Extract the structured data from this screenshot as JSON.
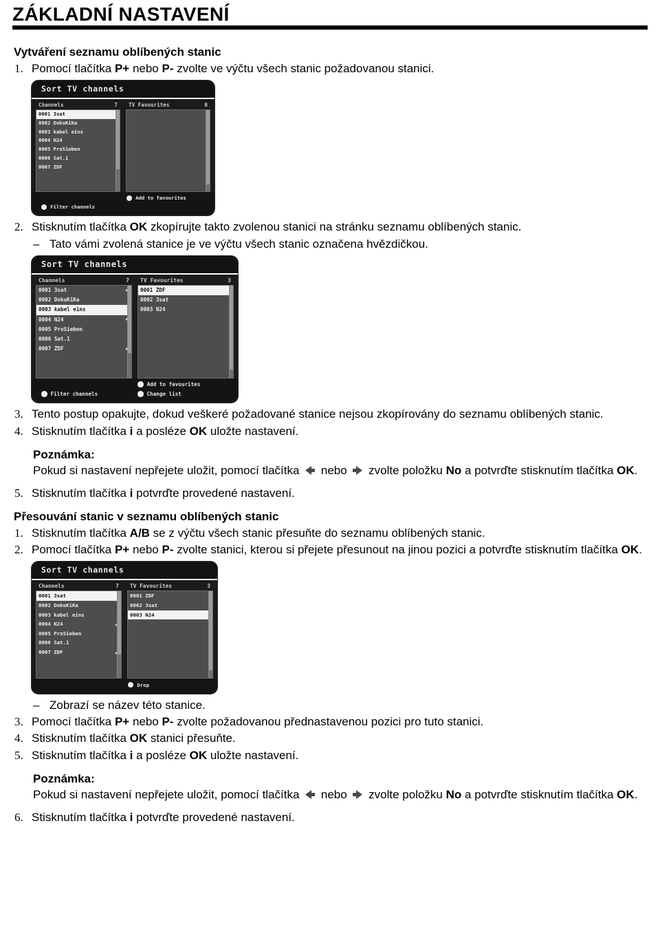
{
  "header": {
    "title": "ZÁKLADNÍ NASTAVENÍ"
  },
  "section1": {
    "heading": "Vytváření seznamu oblíbených stanic",
    "items": [
      {
        "num": "1.",
        "html": "Pomocí tlačítka <b>P+</b> nebo <b>P-</b> zvolte ve výčtu všech stanic požadovanou stanici."
      },
      {
        "num": "2.",
        "html": "Stisknutím tlačítka <b>OK</b> zkopírujte takto zvolenou stanici na stránku seznamu oblíbených stanic."
      },
      {
        "num": "3.",
        "html": "Tento postup opakujte, dokud veškeré požadované stanice nejsou zkopírovány do seznamu oblíbených stanic."
      },
      {
        "num": "4.",
        "html": "Stisknutím tlačítka <b>i</b> a posléze <b>OK</b> uložte nastavení."
      },
      {
        "num": "5.",
        "html": "Stisknutím tlačítka <b>i</b> potvrďte provedené nastavení."
      }
    ],
    "dash_note": "Tato vámi zvolená stanice je ve výčtu všech stanic označena hvězdičkou.",
    "note_heading": "Poznámka:",
    "note_html": "Pokud si nastavení nepřejete uložit, pomocí tlačítka <span class=\"arrow-ico\" data-name=\"arrow-left-icon\"><svg width=\"18\" height=\"15\" viewBox=\"0 0 18 15\"><polygon points=\"2,7.5 11,1 11,5 16,5 16,10 11,10 11,14\" fill=\"#4a4a4a\"/></svg></span> nebo <span class=\"arrow-ico\" data-name=\"arrow-right-icon\"><svg width=\"18\" height=\"15\" viewBox=\"0 0 18 15\"><polygon points=\"16,7.5 7,1 7,5 2,5 2,10 7,10 7,14\" fill=\"#4a4a4a\"/></svg></span> zvolte položku <b>No</b> a potvrďte stisknutím tlačítka <b>OK</b>."
  },
  "section2": {
    "heading": "Přesouvání stanic v seznamu oblíbených stanic",
    "items": [
      {
        "num": "1.",
        "html": "Stisknutím tlačítka <b>A/B</b> se z výčtu všech stanic přesuňte do seznamu oblíbených stanic."
      },
      {
        "num": "2.",
        "html": "Pomocí tlačítka <b>P+</b> nebo <b>P-</b> zvolte stanici, kterou si přejete přesunout na jinou pozici a potvrďte stisknutím tlačítka <b>OK</b>."
      },
      {
        "num": "3.",
        "html": "Pomocí tlačítka <b>P+</b> nebo <b>P-</b> zvolte požadovanou přednastavenou pozici pro tuto stanici."
      },
      {
        "num": "4.",
        "html": "Stisknutím tlačítka <b>OK</b> stanici přesuňte."
      },
      {
        "num": "5.",
        "html": "Stisknutím tlačítka <b>i</b> a posléze <b>OK</b> uložte nastavení."
      },
      {
        "num": "6.",
        "html": "Stisknutím tlačítka <b>i</b> potvrďte provedené nastavení."
      }
    ],
    "dash_note": "Zobrazí se název této stanice.",
    "note_heading": "Poznámka:",
    "note_html": "Pokud si nastavení nepřejete uložit, pomocí tlačítka <span class=\"arrow-ico\" data-name=\"arrow-left-icon\"><svg width=\"18\" height=\"15\" viewBox=\"0 0 18 15\"><polygon points=\"2,7.5 11,1 11,5 16,5 16,10 11,10 11,14\" fill=\"#4a4a4a\"/></svg></span> nebo <span class=\"arrow-ico\" data-name=\"arrow-right-icon\"><svg width=\"18\" height=\"15\" viewBox=\"0 0 18 15\"><polygon points=\"16,7.5 7,1 7,5 2,5 2,10 7,10 7,14\" fill=\"#4a4a4a\"/></svg></span> zvolte položku <b>No</b> a potvrďte stisknutím tlačítka <b>OK</b>."
  },
  "osd_screens": [
    {
      "id": "osd-1",
      "title": "Sort TV channels",
      "left_header": "Channels",
      "left_count": "7",
      "right_header": "TV Favourites",
      "right_count": "0",
      "channels": [
        {
          "num": "0001",
          "name": "3sat",
          "selected": true,
          "star": false
        },
        {
          "num": "0002",
          "name": "DokuKiKa",
          "selected": false,
          "star": false
        },
        {
          "num": "0003",
          "name": "kabel eins",
          "selected": false,
          "star": false
        },
        {
          "num": "0004",
          "name": "N24",
          "selected": false,
          "star": false
        },
        {
          "num": "0005",
          "name": "ProSieben",
          "selected": false,
          "star": false
        },
        {
          "num": "0006",
          "name": "Sat.1",
          "selected": false,
          "star": false
        },
        {
          "num": "0007",
          "name": "ZDF",
          "selected": false,
          "star": false
        }
      ],
      "favourites": [],
      "footer_left": "Filter channels",
      "footer_mid": "Add to favourites",
      "footer_mid2": ""
    },
    {
      "id": "osd-2",
      "title": "Sort TV channels",
      "left_header": "Channels",
      "left_count": "7",
      "right_header": "TV Favourites",
      "right_count": "3",
      "channels": [
        {
          "num": "0001",
          "name": "3sat",
          "selected": false,
          "star": true
        },
        {
          "num": "0002",
          "name": "DokuKiKa",
          "selected": false,
          "star": false
        },
        {
          "num": "0003",
          "name": "kabel eins",
          "selected": true,
          "star": false
        },
        {
          "num": "0004",
          "name": "N24",
          "selected": false,
          "star": true
        },
        {
          "num": "0005",
          "name": "ProSieben",
          "selected": false,
          "star": false
        },
        {
          "num": "0006",
          "name": "Sat.1",
          "selected": false,
          "star": false
        },
        {
          "num": "0007",
          "name": "ZDF",
          "selected": false,
          "star": true
        }
      ],
      "favourites": [
        {
          "num": "0001",
          "name": "ZDF",
          "selected": true
        },
        {
          "num": "0002",
          "name": "3sat",
          "selected": false
        },
        {
          "num": "0003",
          "name": "N24",
          "selected": false
        }
      ],
      "footer_left": "Filter channels",
      "footer_mid": "Add to favourites",
      "footer_mid2": "Change list"
    },
    {
      "id": "osd-3",
      "title": "Sort TV channels",
      "left_header": "Channels",
      "left_count": "7",
      "right_header": "TV Favourites",
      "right_count": "3",
      "channels": [
        {
          "num": "0001",
          "name": "3sat",
          "selected": true,
          "star": true
        },
        {
          "num": "0002",
          "name": "DokuKiKa",
          "selected": false,
          "star": false
        },
        {
          "num": "0003",
          "name": "kabel eins",
          "selected": false,
          "star": false
        },
        {
          "num": "0004",
          "name": "N24",
          "selected": false,
          "star": true
        },
        {
          "num": "0005",
          "name": "ProSieben",
          "selected": false,
          "star": false
        },
        {
          "num": "0006",
          "name": "Sat.1",
          "selected": false,
          "star": false
        },
        {
          "num": "0007",
          "name": "ZDF",
          "selected": false,
          "star": true
        }
      ],
      "favourites": [
        {
          "num": "0001",
          "name": "ZDF",
          "selected": false
        },
        {
          "num": "0002",
          "name": "3sat",
          "selected": false
        },
        {
          "num": "0003",
          "name": "N24",
          "selected": true
        }
      ],
      "footer_left": "",
      "footer_mid": "Drop",
      "footer_mid2": ""
    }
  ],
  "colors": {
    "page_bg": "#ffffff",
    "text": "#000000",
    "osd_frame": "#1b1b1b",
    "osd_titlebar": "#121212",
    "osd_list_bg": "#4d4d4d",
    "osd_selected_bg": "#f2f2f2",
    "arrow_fill": "#4a4a4a"
  }
}
